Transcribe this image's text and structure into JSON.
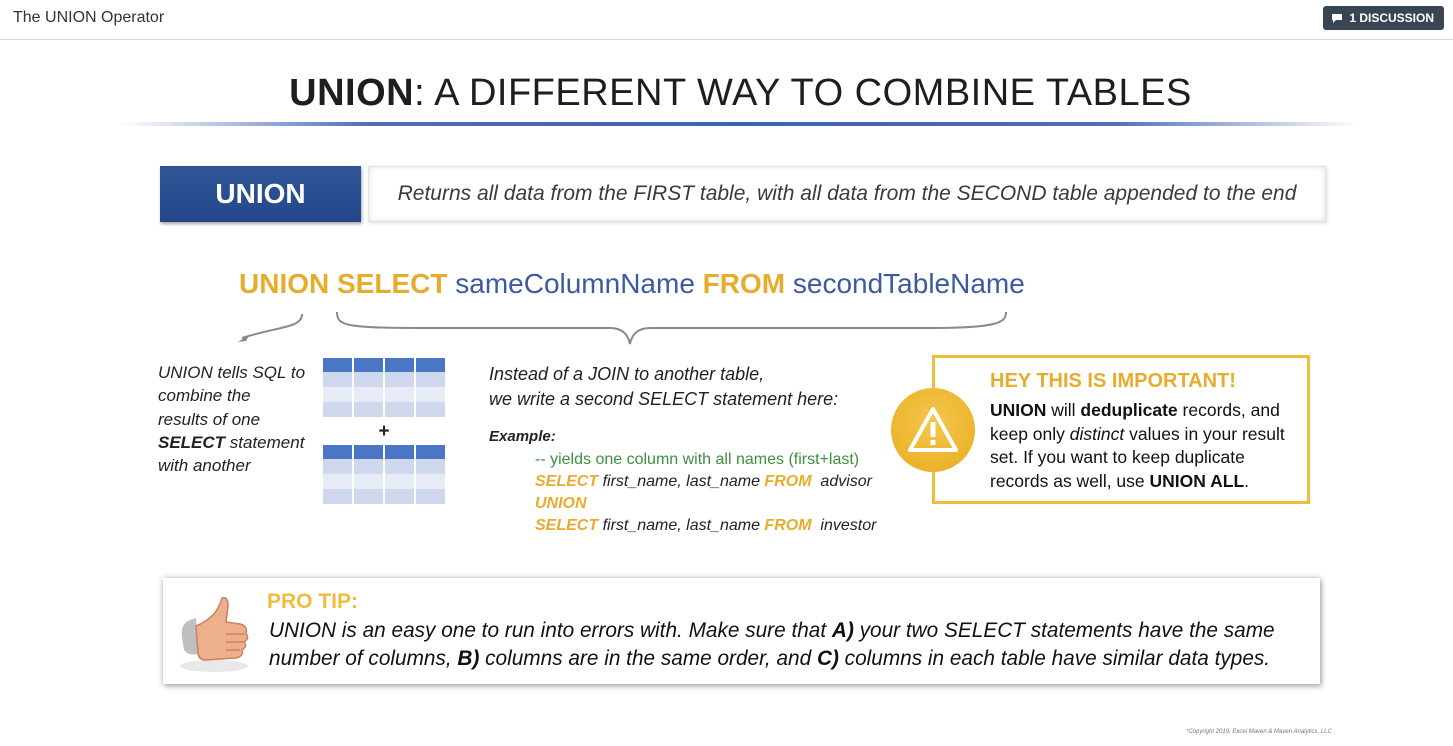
{
  "topbar": {
    "title": "The UNION Operator",
    "discussion_label": "1 DISCUSSION"
  },
  "slide": {
    "title_bold": "UNION",
    "title_rest": ": A DIFFERENT WAY TO COMBINE TABLES",
    "union_label": "UNION",
    "definition": "Returns all data from the FIRST table, with all data from the SECOND table appended to the end",
    "syntax": {
      "kw1": "UNION SELECT",
      "col": "sameColumnName",
      "kw2": "FROM",
      "table": "secondTableName"
    },
    "left_note": {
      "line1": "UNION tells SQL to",
      "line2": "combine the",
      "line3": "results of one",
      "bold": "SELECT",
      "line4_rest": " statement",
      "line5": "with another"
    },
    "plus_sign": "+",
    "explain": {
      "line1": "Instead of a JOIN to another table,",
      "line2": "we write a second SELECT statement here:"
    },
    "example": {
      "label": "Example:",
      "comment": "-- yields one column with all names (first+last)",
      "select1_kw": "SELECT",
      "select1_cols": " first_name, last_name ",
      "from1_kw": "FROM",
      "from1_table": "  advisor",
      "union_kw": "UNION",
      "select2_kw": "SELECT",
      "select2_cols": " first_name, last_name ",
      "from2_kw": "FROM",
      "from2_table": "  investor"
    },
    "important": {
      "title": "HEY THIS IS IMPORTANT!",
      "b1": "UNION",
      "t1": " will ",
      "b2": "deduplicate",
      "t2": " records, and keep only ",
      "i1": "distinct",
      "t3": " values in your result set. If you want to keep duplicate records as well, use ",
      "b3": "UNION ALL",
      "t4": "."
    },
    "protip": {
      "title": "PRO TIP:",
      "t1": "UNION is an easy one to run into errors with. Make sure that ",
      "b1": "A)",
      "t2": " your two SELECT statements have the same number of columns, ",
      "b2": "B)",
      "t3": " columns are in the same order, and ",
      "b3": "C)",
      "t4": " columns in each table have similar data types."
    },
    "copyright": "*Copyright 2019, Excel Maven & Maven Analytics, LLC"
  },
  "colors": {
    "accent_yellow": "#e8ac2c",
    "accent_blue": "#2f5597",
    "ident_blue": "#3b5aa1",
    "comment_green": "#3e8f3e"
  },
  "icons": [
    "chat-icon",
    "warning-icon",
    "thumbs-up-icon",
    "table-icon"
  ]
}
